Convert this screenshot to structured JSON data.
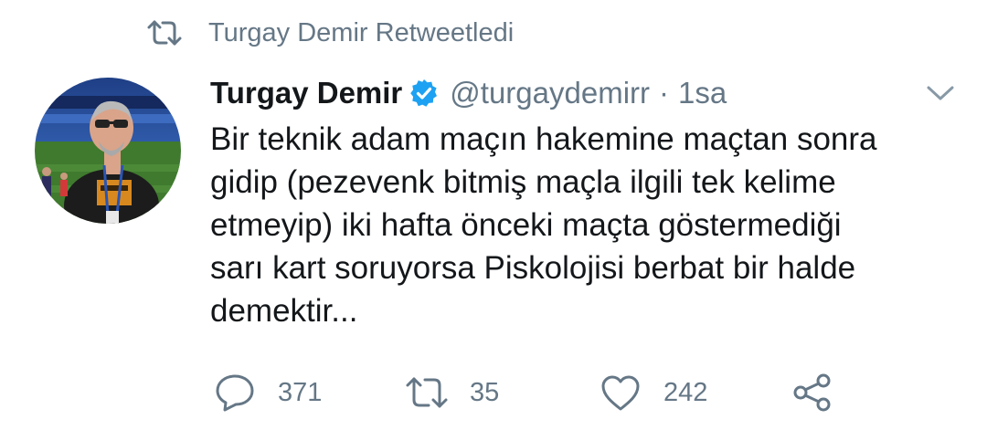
{
  "social_context": {
    "text": "Turgay Demir Retweetledi",
    "icon": "retweet-icon"
  },
  "tweet": {
    "author_name": "Turgay Demir",
    "verified": true,
    "handle": "@turgaydemirr",
    "separator": "·",
    "time": "1sa",
    "text_lines": [
      "Bir teknik adam maçın hakemine maçtan sonra",
      "gidip (pezevenk bitmiş maçla ilgili tek kelime",
      "etmeyip) iki hafta önceki maçta göstermediği",
      "sarı kart soruyorsa Piskolojisi berbat bir halde",
      "demektir..."
    ]
  },
  "actions": {
    "reply_count": "371",
    "retweet_count": "35",
    "like_count": "242"
  },
  "colors": {
    "text": "#14171a",
    "secondary": "#657786",
    "verified": "#1da1f2"
  }
}
